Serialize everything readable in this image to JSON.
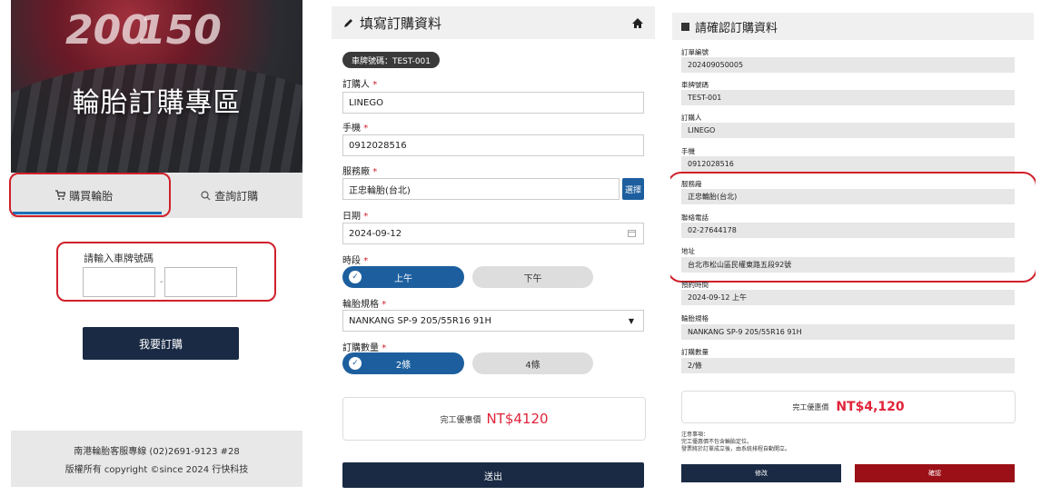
{
  "panel1": {
    "hero_title": "輪胎訂購專區",
    "hero_numbers": [
      "200",
      "150"
    ],
    "tabs": [
      {
        "label": "購買輪胎",
        "icon": "cart-icon",
        "active": true
      },
      {
        "label": "查詢訂購",
        "icon": "search-icon",
        "active": false
      }
    ],
    "plate_label": "請輸入車牌號碼",
    "plate_separator": "-",
    "order_button": "我要訂購",
    "footer_line1": "南港輪胎客服專線 (02)2691-9123 #28",
    "footer_line2": "版權所有 copyright ©since 2024 行快科技"
  },
  "panel2": {
    "title": "填寫訂購資料",
    "title_icon": "pencil-icon",
    "home_icon": "home-icon",
    "plate_chip": "車牌號碼：TEST-001",
    "required_mark": "*",
    "fields": {
      "buyer_label": "訂購人",
      "buyer_value": "LINEGO",
      "phone_label": "手機",
      "phone_value": "0912028516",
      "shop_label": "服務廠",
      "shop_value": "正忠輪胎(台北)",
      "shop_button": "選擇",
      "date_label": "日期",
      "date_value": "2024-09-12",
      "period_label": "時段",
      "period_options": [
        "上午",
        "下午"
      ],
      "period_selected": "上午",
      "spec_label": "輪胎規格",
      "spec_value": "NANKANG SP-9 205/55R16 91H",
      "qty_label": "訂購數量",
      "qty_options": [
        "2條",
        "4條"
      ],
      "qty_selected": "2條"
    },
    "price_label": "完工優惠價",
    "price_value": "NT$4120",
    "submit_button": "送出"
  },
  "panel3": {
    "title": "請確認訂購資料",
    "rows": [
      {
        "label": "訂單編號",
        "value": "202409050005"
      },
      {
        "label": "車牌號碼",
        "value": "TEST-001"
      },
      {
        "label": "訂購人",
        "value": "LINEGO"
      },
      {
        "label": "手機",
        "value": "0912028516"
      },
      {
        "label": "服務廠",
        "value": "正忠輪胎(台北)"
      },
      {
        "label": "聯絡電話",
        "value": "02-27644178"
      },
      {
        "label": "地址",
        "value": "台北市松山區民權東路五段92號"
      },
      {
        "label": "預約時間",
        "value": "2024-09-12 上午"
      },
      {
        "label": "輪胎規格",
        "value": "NANKANG SP-9 205/55R16 91H"
      },
      {
        "label": "訂購數量",
        "value": "2/條"
      }
    ],
    "price_label": "完工優惠價",
    "price_value": "NT$4,120",
    "notes": [
      "注意事項：",
      "完工優惠價不包含輪胎定位。",
      "發票將於訂單成立後，由系統排程自動開立。"
    ],
    "edit_button": "修改",
    "confirm_button": "確認"
  },
  "colors": {
    "highlight_red": "#d0202a",
    "primary_navy": "#1a2a44",
    "accent_blue": "#1d5f9e",
    "price_red": "#e0243a",
    "confirm_red": "#9b0f16"
  }
}
